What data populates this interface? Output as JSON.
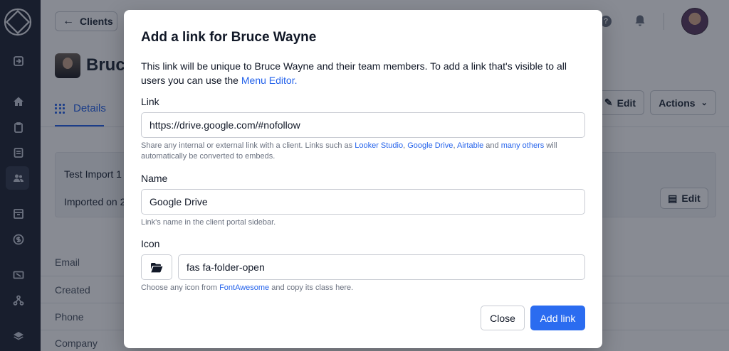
{
  "background": {
    "back_button": "Clients",
    "client_name": "Bruce",
    "tab_details": "Details",
    "edit_label": "Edit",
    "actions_label": "Actions",
    "note_title": "Test Import 1",
    "note_date": "Imported on 2",
    "detail_labels": [
      "Email",
      "Created",
      "Phone",
      "Company"
    ],
    "help_glyph": "?"
  },
  "modal": {
    "title": "Add a link for Bruce Wayne",
    "description": "This link will be unique to Bruce Wayne and their team members. To add a link that's visible to all users you can use the ",
    "menu_editor_link": "Menu Editor.",
    "link_label": "Link",
    "link_value": "https://drive.google.com/#nofollow",
    "link_help_prefix": "Share any internal or external link with a client. Links such as ",
    "link_help_looker": "Looker Studio",
    "link_help_drive": "Google Drive",
    "link_help_airtable": "Airtable",
    "link_help_and": " and ",
    "link_help_many": "many others",
    "link_help_suffix": " will automatically be converted to embeds.",
    "link_help_comma": ", ",
    "name_label": "Name",
    "name_value": "Google Drive",
    "name_help": "Link's name in the client portal sidebar.",
    "icon_label": "Icon",
    "icon_value": "fas fa-folder-open",
    "icon_help_prefix": "Choose any icon from ",
    "icon_help_link": "FontAwesome",
    "icon_help_suffix": " and copy its class here.",
    "close_label": "Close",
    "add_label": "Add link"
  },
  "colors": {
    "accent": "#2563eb",
    "primary_button": "#2b6cf0",
    "sidebar": "#1e2433"
  }
}
